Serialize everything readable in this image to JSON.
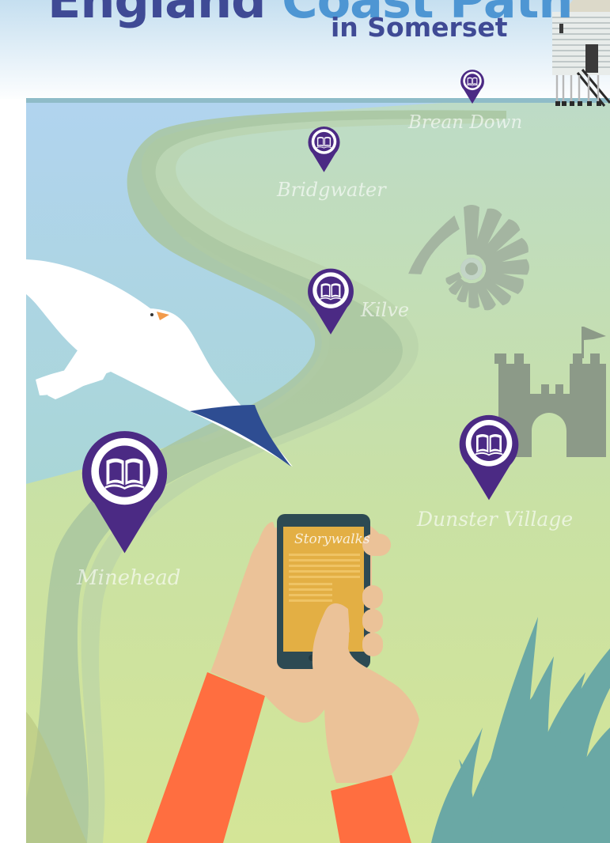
{
  "title": {
    "line1_part1": "England",
    "line1_part2": "Coast Path",
    "line2": "in Somerset"
  },
  "places": [
    {
      "name": "Brean Down"
    },
    {
      "name": "Bridgwater"
    },
    {
      "name": "Kilve"
    },
    {
      "name": "Dunster Village"
    },
    {
      "name": "Minehead"
    }
  ],
  "phone": {
    "app_name": "Storywalks"
  },
  "icons": {
    "marker": "book-map-pin-icon",
    "lighthouse": "lighthouse-icon",
    "ammonite": "ammonite-icon",
    "castle": "castle-icon",
    "bird": "seagull-icon"
  },
  "colors": {
    "title_dark": "#3f4a95",
    "title_accent": "#4e96d3",
    "pin_purple": "#4b2a84",
    "sea": "#b3d5ec",
    "land": "#cfe29b",
    "path": "#a9c79a",
    "sleeve": "#ff6e40",
    "skin": "#ebc298",
    "phone_screen": "#e3af44"
  }
}
